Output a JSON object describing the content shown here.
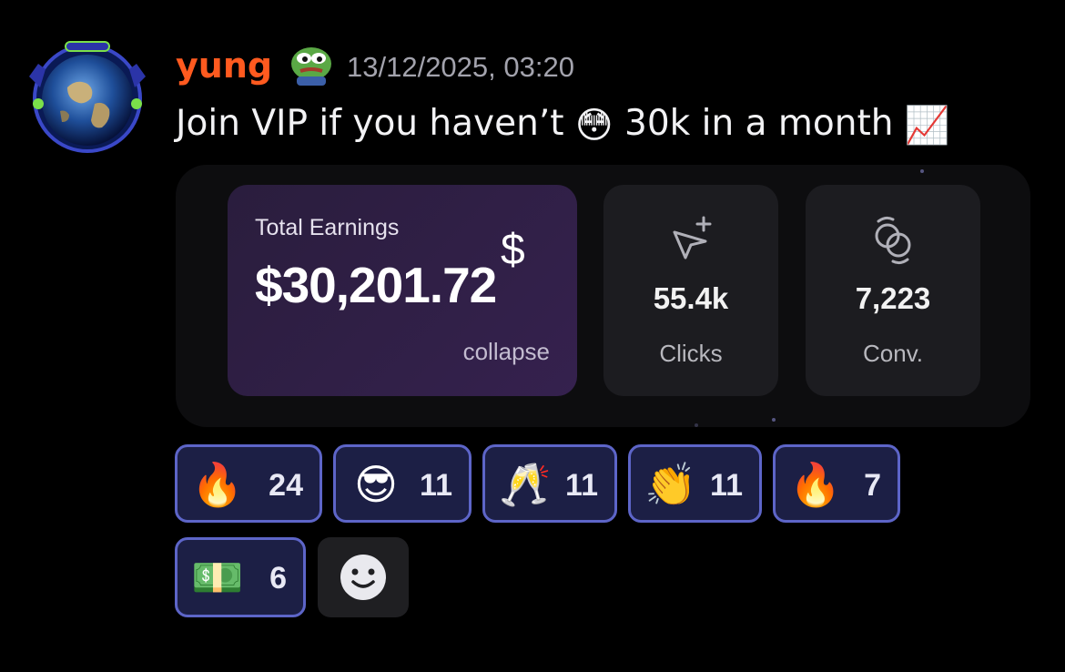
{
  "message": {
    "author": "yung",
    "timestamp": "13/12/2025, 03:20",
    "text_parts": [
      "Join VIP if you haven’t ",
      "😳",
      " 30k in a month ",
      "📈"
    ],
    "author_color": "#ff5a1f",
    "avatar_icon": "earth-globe-avatar",
    "role_icon": "pepe-frog-icon"
  },
  "embed": {
    "earnings_title": "Total Earnings",
    "earnings_amount": "$30,201.72",
    "earnings_icon": "$",
    "earnings_action": "collapse",
    "clicks_value": "55.4k",
    "clicks_label": "Clicks",
    "clicks_icon": "cursor-plus-icon",
    "conv_value": "7,223",
    "conv_label": "Conv.",
    "conv_icon": "convert-rings-icon"
  },
  "reactions": [
    {
      "emoji": "🔥",
      "count": "24",
      "name": "fire"
    },
    {
      "emoji": "😎",
      "count": "11",
      "name": "cool-face"
    },
    {
      "emoji": "🥂",
      "count": "11",
      "name": "champagne-toast"
    },
    {
      "emoji": "👏",
      "count": "11",
      "name": "clapping-hands"
    },
    {
      "emoji": "🔥",
      "count": "7",
      "name": "money-fire"
    },
    {
      "emoji": "💵",
      "count": "6",
      "name": "cash-stack"
    }
  ],
  "add_reaction_icon": "smiley-add-reaction-icon",
  "colors": {
    "reaction_bg": "#1c1f45",
    "reaction_border": "#5d65c8",
    "earn_card_bg": "#2a1d3d"
  }
}
